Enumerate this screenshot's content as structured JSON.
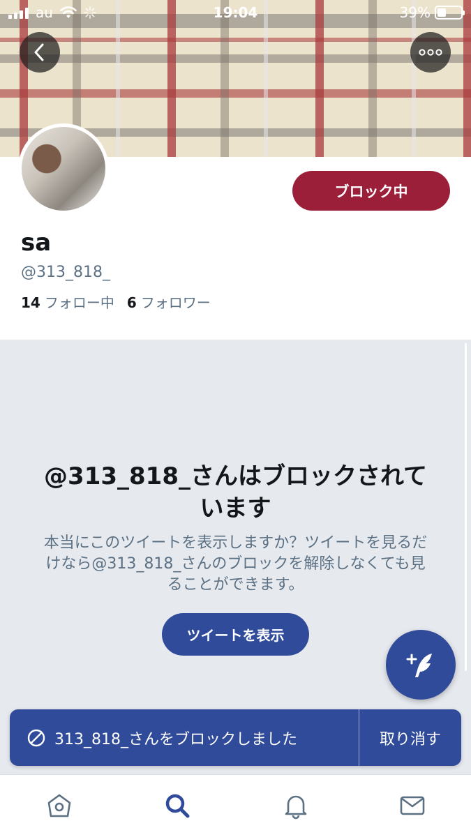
{
  "status_bar": {
    "carrier": "au",
    "time": "19:04",
    "battery": "39%",
    "battery_level": 0.39
  },
  "profile": {
    "block_button": "ブロック中",
    "display_name": "sa",
    "handle": "@313_818_",
    "following_count": "14",
    "following_label": "フォロー中",
    "followers_count": "6",
    "followers_label": "フォロワー"
  },
  "blocked_notice": {
    "title": "@313_818_さんはブロックされています",
    "description": "本当にこのツイートを表示しますか？ツイートを見るだけなら@313_818_さんのブロックを解除しなくても見ることができます。",
    "show_button": "ツイートを表示"
  },
  "toast": {
    "message": "313_818_さんをブロックしました",
    "undo": "取り消す"
  },
  "icons": [
    "back-icon",
    "more-icon",
    "compose-icon",
    "block-icon",
    "home-icon",
    "search-icon",
    "notifications-icon",
    "messages-icon"
  ],
  "colors": {
    "accent": "#2f4b9a",
    "block_red": "#9c1f3a",
    "secondary_text": "#5b7083",
    "background_gray": "#e6e9ee"
  }
}
